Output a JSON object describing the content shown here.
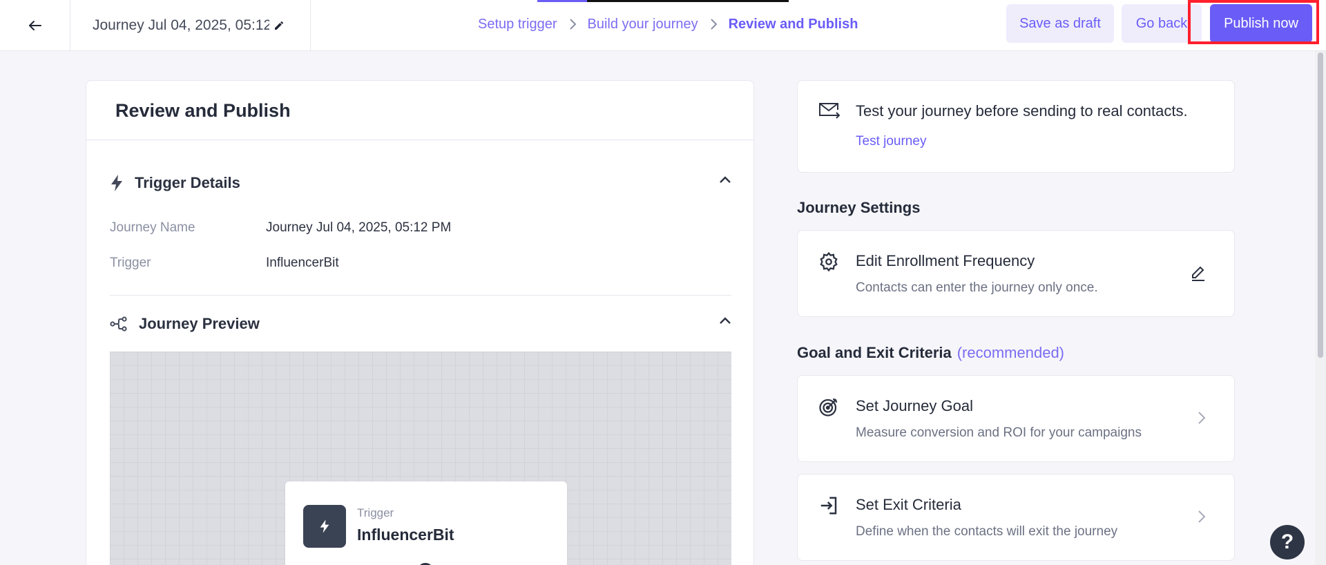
{
  "header": {
    "journey_title": "Journey Jul 04, 2025, 05:12",
    "breadcrumbs": [
      "Setup trigger",
      "Build your journey",
      "Review and Publish"
    ],
    "save_draft_label": "Save as draft",
    "go_back_label": "Go back",
    "publish_label": "Publish now"
  },
  "review": {
    "title": "Review and Publish",
    "trigger_section": {
      "label": "Trigger Details",
      "journey_name_key": "Journey Name",
      "journey_name_value": "Journey Jul 04, 2025, 05:12 PM",
      "trigger_key": "Trigger",
      "trigger_value": "InfluencerBit"
    },
    "preview_section": {
      "label": "Journey Preview",
      "card_small": "Trigger",
      "card_name": "InfluencerBit"
    }
  },
  "test_card": {
    "title": "Test your journey before sending to real contacts.",
    "link": "Test journey"
  },
  "journey_settings": {
    "label": "Journey Settings",
    "enrollment": {
      "title": "Edit Enrollment Frequency",
      "subtitle": "Contacts can enter the journey only once."
    }
  },
  "goal_exit": {
    "label": "Goal and Exit Criteria",
    "muted": "(recommended)",
    "goal": {
      "title": "Set Journey Goal",
      "subtitle": "Measure conversion and ROI for your campaigns"
    },
    "exit": {
      "title": "Set Exit Criteria",
      "subtitle": "Define when the contacts will exit the journey"
    }
  },
  "help_label": "?",
  "colors": {
    "accent": "#6a5cf6",
    "accent_light": "#efedfc",
    "highlight": "#ff1f2d",
    "text_dark": "#252b3a"
  }
}
